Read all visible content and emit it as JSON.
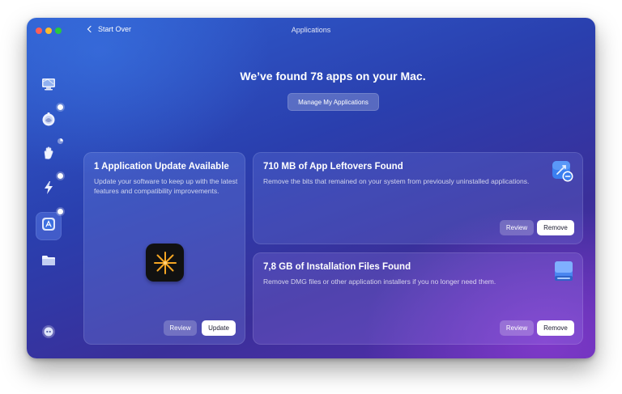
{
  "window": {
    "title": "Applications"
  },
  "nav": {
    "start_over": "Start Over"
  },
  "headline": "We’ve found 78 apps on your Mac.",
  "manage_button": "Manage My Applications",
  "sidebar": {
    "items": [
      {
        "icon": "monitor-icon",
        "active": false,
        "badge": "none"
      },
      {
        "icon": "shield-icon",
        "active": false,
        "badge": "dot"
      },
      {
        "icon": "hand-icon",
        "active": false,
        "badge": "pie"
      },
      {
        "icon": "lightning-icon",
        "active": false,
        "badge": "dot"
      },
      {
        "icon": "app-store-icon",
        "active": true,
        "badge": "dot"
      },
      {
        "icon": "folder-icon",
        "active": false,
        "badge": "none"
      }
    ],
    "bottom_icon": "assistant-icon"
  },
  "cards": {
    "update": {
      "title": "1 Application Update Available",
      "description": "Update your software to keep up with the latest features and compatibility improvements.",
      "review_label": "Review",
      "action_label": "Update",
      "app_icon": "sparkle-app-icon"
    },
    "leftovers": {
      "title": "710 MB of App Leftovers Found",
      "description": "Remove the bits that remained on your system from previously uninstalled applications.",
      "review_label": "Review",
      "action_label": "Remove",
      "icon": "uninstaller-icon"
    },
    "installers": {
      "title": "7,8 GB of Installation Files Found",
      "description": "Remove DMG files or other application installers if you no longer need them.",
      "review_label": "Review",
      "action_label": "Remove",
      "icon": "disk-image-icon"
    }
  },
  "colors": {
    "traffic_red": "#ff5f57",
    "traffic_yellow": "#febc2e",
    "traffic_green": "#28c840",
    "accent_orange": "#f5a623"
  }
}
